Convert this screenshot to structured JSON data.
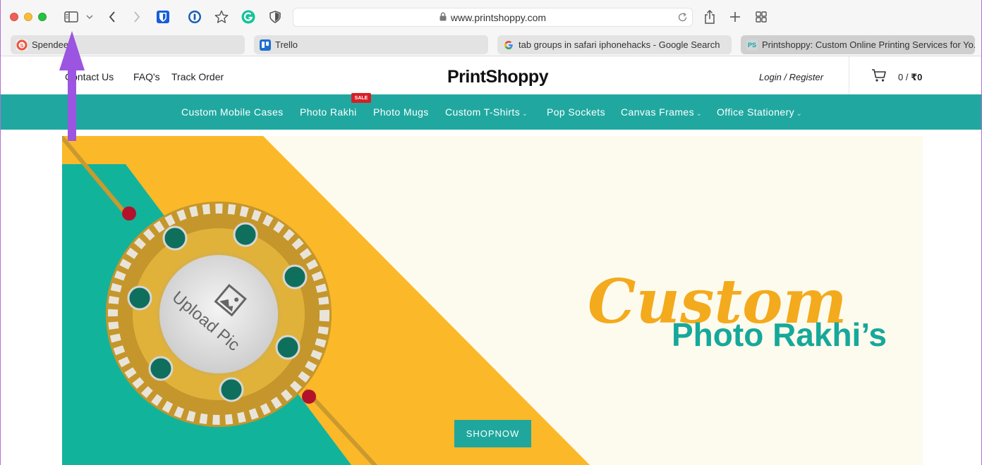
{
  "browser": {
    "url": "www.printshoppy.com",
    "tabs": [
      {
        "label": "Spendee"
      },
      {
        "label": "Trello"
      },
      {
        "label": "tab groups in safari iphonehacks - Google Search"
      },
      {
        "label": "Printshoppy: Custom Online Printing Services for Yo..."
      }
    ],
    "icons": [
      "sidebar-icon",
      "chevron-down-icon",
      "back-icon",
      "forward-icon",
      "bitwarden-icon",
      "onepassword-icon",
      "star-icon",
      "grammarly-icon",
      "shield-icon",
      "lock-icon",
      "reload-icon",
      "share-icon",
      "new-tab-icon",
      "tab-overview-icon"
    ],
    "colors": {
      "accent": "#20a8a0",
      "annotation_arrow": "#9b55e0"
    }
  },
  "header": {
    "links": [
      "Contact Us",
      "FAQ's",
      "Track Order"
    ],
    "logo": "PrintShoppy",
    "login": "Login / Register",
    "cart": {
      "prefix": "0 / ",
      "amount": "₹0"
    }
  },
  "nav": {
    "items": [
      {
        "label": "Custom Mobile Cases"
      },
      {
        "label": "Photo Rakhi",
        "badge": "SALE"
      },
      {
        "label": "Photo Mugs"
      },
      {
        "label": "Custom T-Shirts",
        "dropdown": true
      },
      {
        "label": "Pop Sockets"
      },
      {
        "label": "Canvas Frames",
        "dropdown": true
      },
      {
        "label": "Office Stationery",
        "dropdown": true
      }
    ]
  },
  "hero": {
    "title_script": "Custom",
    "title": "Photo Rakhi’s",
    "upload_label": "Upload Pic",
    "cta": "SHOPNOW"
  }
}
